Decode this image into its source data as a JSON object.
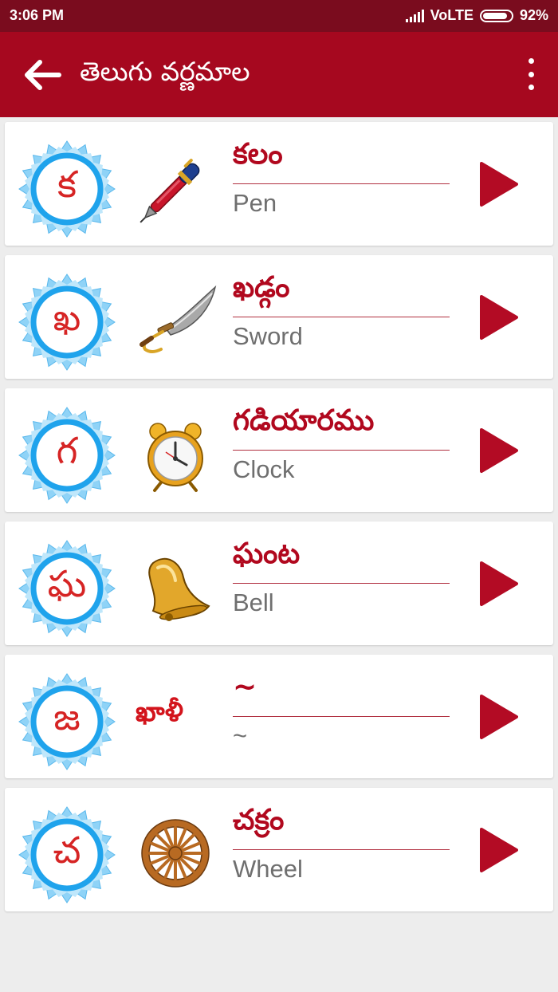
{
  "status_bar": {
    "time": "3:06 PM",
    "network": "VoLTE",
    "battery": "92%"
  },
  "app_bar": {
    "title": "తెలుగు వర్ణమాల"
  },
  "colors": {
    "app_bar": "#a6081f",
    "status_bar": "#7a0c1e",
    "accent_red": "#b1081e",
    "badge_blue": "#1fa3ec",
    "play_red": "#b30b24"
  },
  "items": [
    {
      "letter": "క",
      "word_te": "కలం",
      "word_en": "Pen",
      "picture": "pen-icon"
    },
    {
      "letter": "ఖ",
      "word_te": "ఖడ్గం",
      "word_en": "Sword",
      "picture": "sword-icon"
    },
    {
      "letter": "గ",
      "word_te": "గడియారము",
      "word_en": "Clock",
      "picture": "alarm-clock-icon"
    },
    {
      "letter": "ఘ",
      "word_te": "ఘంట",
      "word_en": "Bell",
      "picture": "bell-icon"
    },
    {
      "letter": "జ",
      "word_te": "~",
      "word_en": "~",
      "picture_text": "ఖాళీ"
    },
    {
      "letter": "చ",
      "word_te": "చక్రం",
      "word_en": "Wheel",
      "picture": "wheel-icon"
    }
  ]
}
